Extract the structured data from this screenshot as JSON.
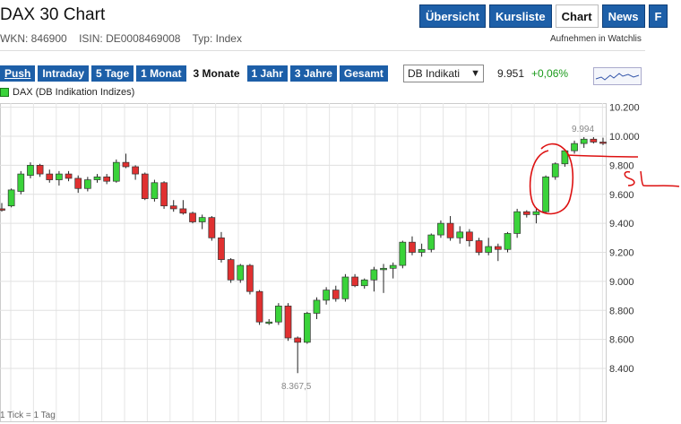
{
  "header": {
    "title": "DAX 30 Chart",
    "wkn": "WKN: 846900",
    "isin": "ISIN: DE0008469008",
    "typ": "Typ: Index",
    "watchlist": "Aufnehmen in Watchlis"
  },
  "topnav": [
    {
      "label": "Übersicht",
      "active": false
    },
    {
      "label": "Kursliste",
      "active": false
    },
    {
      "label": "Chart",
      "active": true
    },
    {
      "label": "News",
      "active": false
    },
    {
      "label": "F",
      "active": false
    }
  ],
  "ranges": [
    {
      "label": "Push",
      "active": false
    },
    {
      "label": "Intraday",
      "active": false
    },
    {
      "label": "5 Tage",
      "active": false
    },
    {
      "label": "1 Monat",
      "active": false
    },
    {
      "label": "3 Monate",
      "active": true
    },
    {
      "label": "1 Jahr",
      "active": false
    },
    {
      "label": "3 Jahre",
      "active": false
    },
    {
      "label": "Gesamt",
      "active": false
    }
  ],
  "exchange_select": {
    "value": "DB Indikati"
  },
  "quote": {
    "last": "9.951",
    "change": "+0,06%"
  },
  "colors": {
    "up": "#3ad33a",
    "down": "#e03030",
    "accent": "#1d5fa8",
    "annotation": "#dd1111"
  },
  "footer": "1 Tick = 1 Tag",
  "chart_data": {
    "type": "candlestick",
    "legend": "DAX (DB Indikation Indizes)",
    "y_ticks": [
      "10.200",
      "10.000",
      "9.800",
      "9.600",
      "9.400",
      "9.200",
      "9.000",
      "8.800",
      "8.600",
      "8.400"
    ],
    "ylim": [
      8350,
      10250
    ],
    "annotations": {
      "high_label": "9.994",
      "low_label": "8.367,5"
    },
    "candles": [
      [
        9500,
        9540,
        9480,
        9490
      ],
      [
        9520,
        9640,
        9510,
        9630
      ],
      [
        9620,
        9760,
        9600,
        9740
      ],
      [
        9730,
        9820,
        9710,
        9800
      ],
      [
        9800,
        9810,
        9720,
        9740
      ],
      [
        9740,
        9770,
        9680,
        9700
      ],
      [
        9700,
        9760,
        9660,
        9740
      ],
      [
        9740,
        9760,
        9690,
        9710
      ],
      [
        9710,
        9730,
        9610,
        9640
      ],
      [
        9640,
        9720,
        9620,
        9700
      ],
      [
        9700,
        9740,
        9680,
        9720
      ],
      [
        9720,
        9740,
        9670,
        9690
      ],
      [
        9690,
        9840,
        9680,
        9820
      ],
      [
        9820,
        9880,
        9780,
        9790
      ],
      [
        9790,
        9800,
        9700,
        9740
      ],
      [
        9740,
        9750,
        9560,
        9570
      ],
      [
        9570,
        9700,
        9550,
        9680
      ],
      [
        9680,
        9690,
        9500,
        9520
      ],
      [
        9520,
        9560,
        9480,
        9500
      ],
      [
        9500,
        9560,
        9460,
        9470
      ],
      [
        9470,
        9480,
        9400,
        9410
      ],
      [
        9410,
        9460,
        9360,
        9440
      ],
      [
        9440,
        9450,
        9280,
        9300
      ],
      [
        9300,
        9340,
        9130,
        9150
      ],
      [
        9150,
        9160,
        8990,
        9010
      ],
      [
        9010,
        9120,
        8990,
        9110
      ],
      [
        9110,
        9120,
        8910,
        8930
      ],
      [
        8930,
        8940,
        8700,
        8720
      ],
      [
        8720,
        8740,
        8700,
        8720
      ],
      [
        8720,
        8850,
        8700,
        8830
      ],
      [
        8830,
        8850,
        8590,
        8610
      ],
      [
        8610,
        8620,
        8367.5,
        8580
      ],
      [
        8580,
        8790,
        8570,
        8780
      ],
      [
        8780,
        8890,
        8740,
        8870
      ],
      [
        8870,
        8960,
        8840,
        8940
      ],
      [
        8940,
        8970,
        8860,
        8880
      ],
      [
        8880,
        9050,
        8860,
        9030
      ],
      [
        9030,
        9050,
        8960,
        8970
      ],
      [
        8970,
        9020,
        8950,
        9010
      ],
      [
        9010,
        9100,
        8930,
        9080
      ],
      [
        9080,
        9120,
        8920,
        9090
      ],
      [
        9090,
        9130,
        9020,
        9110
      ],
      [
        9110,
        9280,
        9090,
        9270
      ],
      [
        9270,
        9310,
        9180,
        9200
      ],
      [
        9200,
        9260,
        9170,
        9220
      ],
      [
        9220,
        9330,
        9200,
        9320
      ],
      [
        9320,
        9420,
        9300,
        9400
      ],
      [
        9400,
        9450,
        9280,
        9300
      ],
      [
        9300,
        9380,
        9260,
        9340
      ],
      [
        9340,
        9360,
        9240,
        9280
      ],
      [
        9280,
        9300,
        9180,
        9200
      ],
      [
        9200,
        9300,
        9180,
        9240
      ],
      [
        9240,
        9260,
        9140,
        9220
      ],
      [
        9220,
        9340,
        9200,
        9330
      ],
      [
        9330,
        9500,
        9300,
        9480
      ],
      [
        9480,
        9490,
        9440,
        9460
      ],
      [
        9460,
        9500,
        9400,
        9480
      ],
      [
        9480,
        9730,
        9470,
        9720
      ],
      [
        9720,
        9820,
        9700,
        9810
      ],
      [
        9810,
        9910,
        9790,
        9900
      ],
      [
        9900,
        9970,
        9880,
        9950
      ],
      [
        9950,
        9994,
        9920,
        9980
      ],
      [
        9980,
        9994,
        9950,
        9960
      ],
      [
        9960,
        9990,
        9940,
        9951
      ]
    ]
  }
}
